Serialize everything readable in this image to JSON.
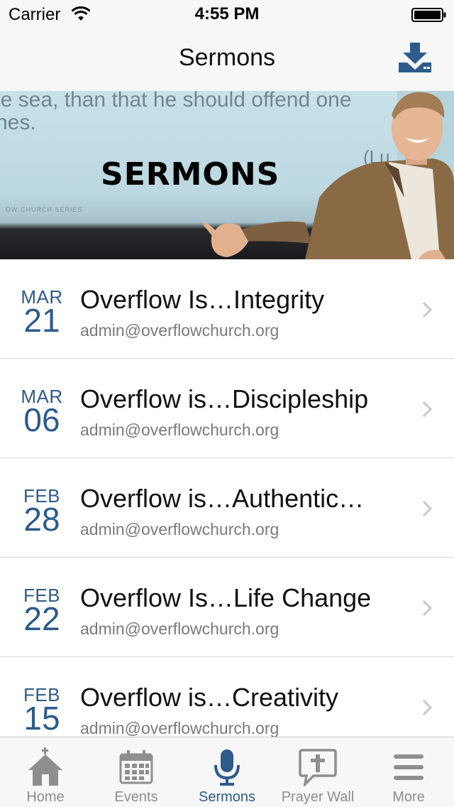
{
  "status_bar": {
    "carrier": "Carrier",
    "time": "4:55 PM"
  },
  "nav": {
    "title": "Sermons",
    "download_icon": "download-icon"
  },
  "banner": {
    "quote_line_1": "le sea, than that he should offend one",
    "quote_line_2": "nes.",
    "quote_ref": "(Lu",
    "series_text": "OW CHURCH SERIES",
    "title": "SERMONS"
  },
  "sermons": [
    {
      "month": "MAR",
      "day": "21",
      "title": "Overflow Is…Integrity",
      "author": "admin@overflowchurch.org"
    },
    {
      "month": "MAR",
      "day": "06",
      "title": "Overflow is…Discipleship",
      "author": "admin@overflowchurch.org"
    },
    {
      "month": "FEB",
      "day": "28",
      "title": "Overflow is…Authentic…",
      "author": "admin@overflowchurch.org"
    },
    {
      "month": "FEB",
      "day": "22",
      "title": "Overflow Is…Life Change",
      "author": "admin@overflowchurch.org"
    },
    {
      "month": "FEB",
      "day": "15",
      "title": "Overflow is…Creativity",
      "author": "admin@overflowchurch.org"
    }
  ],
  "tabs": [
    {
      "label": "Home",
      "icon": "home-icon",
      "active": false
    },
    {
      "label": "Events",
      "icon": "calendar-icon",
      "active": false
    },
    {
      "label": "Sermons",
      "icon": "microphone-icon",
      "active": true
    },
    {
      "label": "Prayer Wall",
      "icon": "prayer-bubble-icon",
      "active": false
    },
    {
      "label": "More",
      "icon": "menu-icon",
      "active": false
    }
  ],
  "colors": {
    "accent": "#2c5b8c",
    "inactive_tab": "#8e8e8e",
    "bar_background": "#f7f7f7"
  }
}
